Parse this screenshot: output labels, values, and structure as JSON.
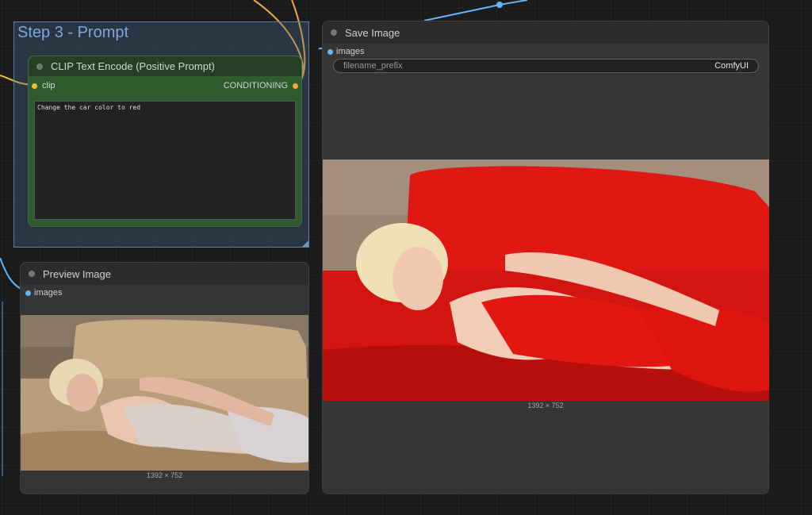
{
  "canvas": {
    "wire_colors": {
      "clip": "#e8c22e",
      "conditioning": "#f4a83a",
      "image": "#64b5f6"
    }
  },
  "group": {
    "title": "Step 3 - Prompt",
    "color": "#5a7fa3"
  },
  "clip_node": {
    "title": "CLIP Text Encode (Positive Prompt)",
    "input_label": "clip",
    "output_label": "CONDITIONING",
    "prompt_text": "Change the car color to red"
  },
  "preview_node": {
    "title": "Preview Image",
    "input_label": "images",
    "image_size": "1392 × 752",
    "image_description": "woman lying on beige leather sofa"
  },
  "save_node": {
    "title": "Save Image",
    "input_label": "images",
    "widget_name": "filename_prefix",
    "widget_value": "ComfyUI",
    "image_size": "1392 × 752",
    "image_description": "woman in red lying on red leather sofa"
  }
}
